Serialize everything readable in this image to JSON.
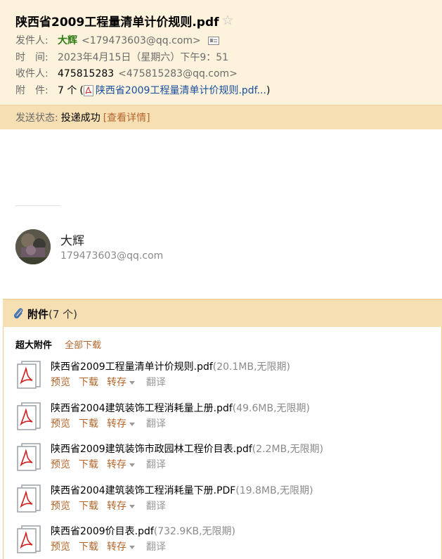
{
  "header": {
    "subject": "陕西省2009工程量清单计价规则.pdf",
    "star_icon": "star-icon",
    "from_label": "发件人:",
    "from_name": "大辉",
    "from_email": "<179473603@qq.com>",
    "time_label": "时　间:",
    "time_value": "2023年4月15日（星期六）下午9：51",
    "to_label": "收件人:",
    "to_name": "475815283",
    "to_email": "<475815283@qq.com>",
    "attach_label": "附　件:",
    "attach_count": "7 个",
    "attach_open": "(",
    "attach_link": "陕西省2009工程量清单计价规则.pdf...",
    "attach_close": ")",
    "status_label": "发送状态:",
    "status_value": "投递成功",
    "status_detail": "[查看详情]"
  },
  "sender": {
    "name": "大辉",
    "email": "179473603@qq.com"
  },
  "attachments": {
    "title": "附件",
    "count": "(7 个)",
    "super_label": "超大附件",
    "download_all": "全部下载",
    "actions": {
      "preview": "预览",
      "download": "下载",
      "save": "转存",
      "translate": "翻译"
    },
    "files": [
      {
        "name": "陕西省2009工程量清单计价规则.pdf",
        "info": "(20.1MB,无限期)"
      },
      {
        "name": "陕西省2004建筑装饰工程消耗量上册.pdf",
        "info": "(49.6MB,无限期)"
      },
      {
        "name": "陕西省2009建筑装饰市政园林工程价目表.pdf",
        "info": "(2.2MB,无限期)"
      },
      {
        "name": "陕西省2004建筑装饰工程消耗量下册.PDF",
        "info": "(19.8MB,无限期)"
      },
      {
        "name": "陕西省2009价目表.pdf",
        "info": "(732.9KB,无限期)"
      }
    ]
  },
  "colors": {
    "header_bg": "#fdf2dc",
    "status_bg": "#f7dfb4",
    "sender_green": "#2e7c13",
    "action_orange": "#b5652b",
    "link_blue": "#1a4fa0"
  }
}
